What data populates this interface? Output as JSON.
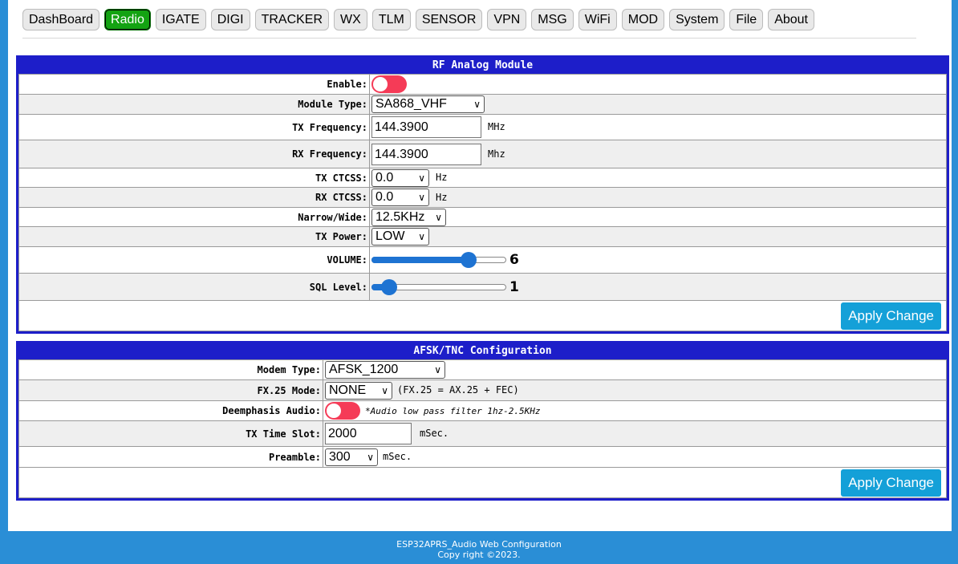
{
  "tabs": [
    {
      "label": "DashBoard"
    },
    {
      "label": "Radio"
    },
    {
      "label": "IGATE"
    },
    {
      "label": "DIGI"
    },
    {
      "label": "TRACKER"
    },
    {
      "label": "WX"
    },
    {
      "label": "TLM"
    },
    {
      "label": "SENSOR"
    },
    {
      "label": "VPN"
    },
    {
      "label": "MSG"
    },
    {
      "label": "WiFi"
    },
    {
      "label": "MOD"
    },
    {
      "label": "System"
    },
    {
      "label": "File"
    },
    {
      "label": "About"
    }
  ],
  "active_tab": "Radio",
  "rf": {
    "title": "RF Analog Module",
    "enable_label": "Enable:",
    "enable_state": "off",
    "module_type_label": "Module Type:",
    "module_type_value": "SA868_VHF",
    "tx_freq_label": "TX Frequency:",
    "tx_freq_value": "144.3900",
    "tx_freq_unit": "MHz",
    "rx_freq_label": "RX Frequency:",
    "rx_freq_value": "144.3900",
    "rx_freq_unit": "Mhz",
    "tx_ctcss_label": "TX CTCSS:",
    "tx_ctcss_value": "0.0",
    "tx_ctcss_unit": "Hz",
    "rx_ctcss_label": "RX CTCSS:",
    "rx_ctcss_value": "0.0",
    "rx_ctcss_unit": "Hz",
    "narrow_wide_label": "Narrow/Wide:",
    "narrow_wide_value": "12.5KHz",
    "tx_power_label": "TX Power:",
    "tx_power_value": "LOW",
    "volume_label": "VOLUME:",
    "volume_value": "6",
    "volume_fraction": 0.72,
    "sql_label": "SQL Level:",
    "sql_value": "1",
    "sql_fraction": 0.13,
    "apply_label": "Apply Change"
  },
  "afsk": {
    "title": "AFSK/TNC Configuration",
    "modem_type_label": "Modem Type:",
    "modem_type_value": "AFSK_1200",
    "fx25_label": "FX.25 Mode:",
    "fx25_value": "NONE",
    "fx25_note": "(FX.25 = AX.25 + FEC)",
    "deemph_label": "Deemphasis Audio:",
    "deemph_state": "off",
    "deemph_note": "*Audio low pass filter 1hz-2.5KHz",
    "tx_slot_label": "TX Time Slot:",
    "tx_slot_value": "2000",
    "tx_slot_unit": "mSec.",
    "preamble_label": "Preamble:",
    "preamble_value": "300",
    "preamble_unit": "mSec.",
    "apply_label": "Apply Change"
  },
  "footer": {
    "line1": "ESP32APRS_Audio Web Configuration",
    "line2": "Copy right ©2023."
  },
  "colors": {
    "panel_border": "#1d1ec9",
    "active_tab": "#13a312",
    "toggle_off": "#f53b57",
    "slider": "#1e73d2",
    "button": "#14a0d8",
    "frame": "#2a8ed6"
  }
}
